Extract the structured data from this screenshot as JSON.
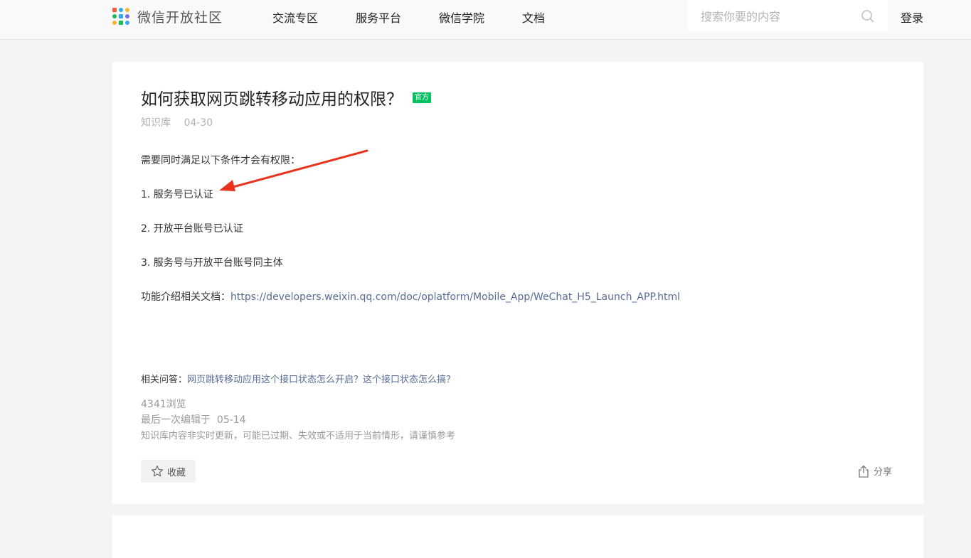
{
  "header": {
    "site_name": "微信开放社区",
    "nav": [
      "交流专区",
      "服务平台",
      "微信学院",
      "文档"
    ],
    "search_placeholder": "搜索你要的内容",
    "login_label": "登录"
  },
  "article": {
    "title": "如何获取网页跳转移动应用的权限？",
    "badge": "官方",
    "category": "知识库",
    "date": "04-30",
    "intro": "需要同时满足以下条件才会有权限：",
    "conditions": [
      "1. 服务号已认证",
      "2. 开放平台账号已认证",
      "3. 服务号与开放平台账号同主体"
    ],
    "doc_label": "功能介绍相关文档：",
    "doc_link": "https://developers.weixin.qq.com/doc/oplatform/Mobile_App/WeChat_H5_Launch_APP.html",
    "related_label": "相关问答：",
    "related_link": "网页跳转移动应用这个接口状态怎么开启？这个接口状态怎么搞？",
    "views": "4341浏览",
    "last_edit_label": "最后一次编辑于",
    "last_edit_date": "05-14",
    "disclaimer": "知识库内容非实时更新，可能已过期、失效或不适用于当前情形，请谨慎参考",
    "favorite_label": "收藏",
    "share_label": "分享"
  },
  "colors": {
    "accent_green": "#07c160",
    "link_blue": "#576b95",
    "annotation_red": "#e8341c"
  }
}
